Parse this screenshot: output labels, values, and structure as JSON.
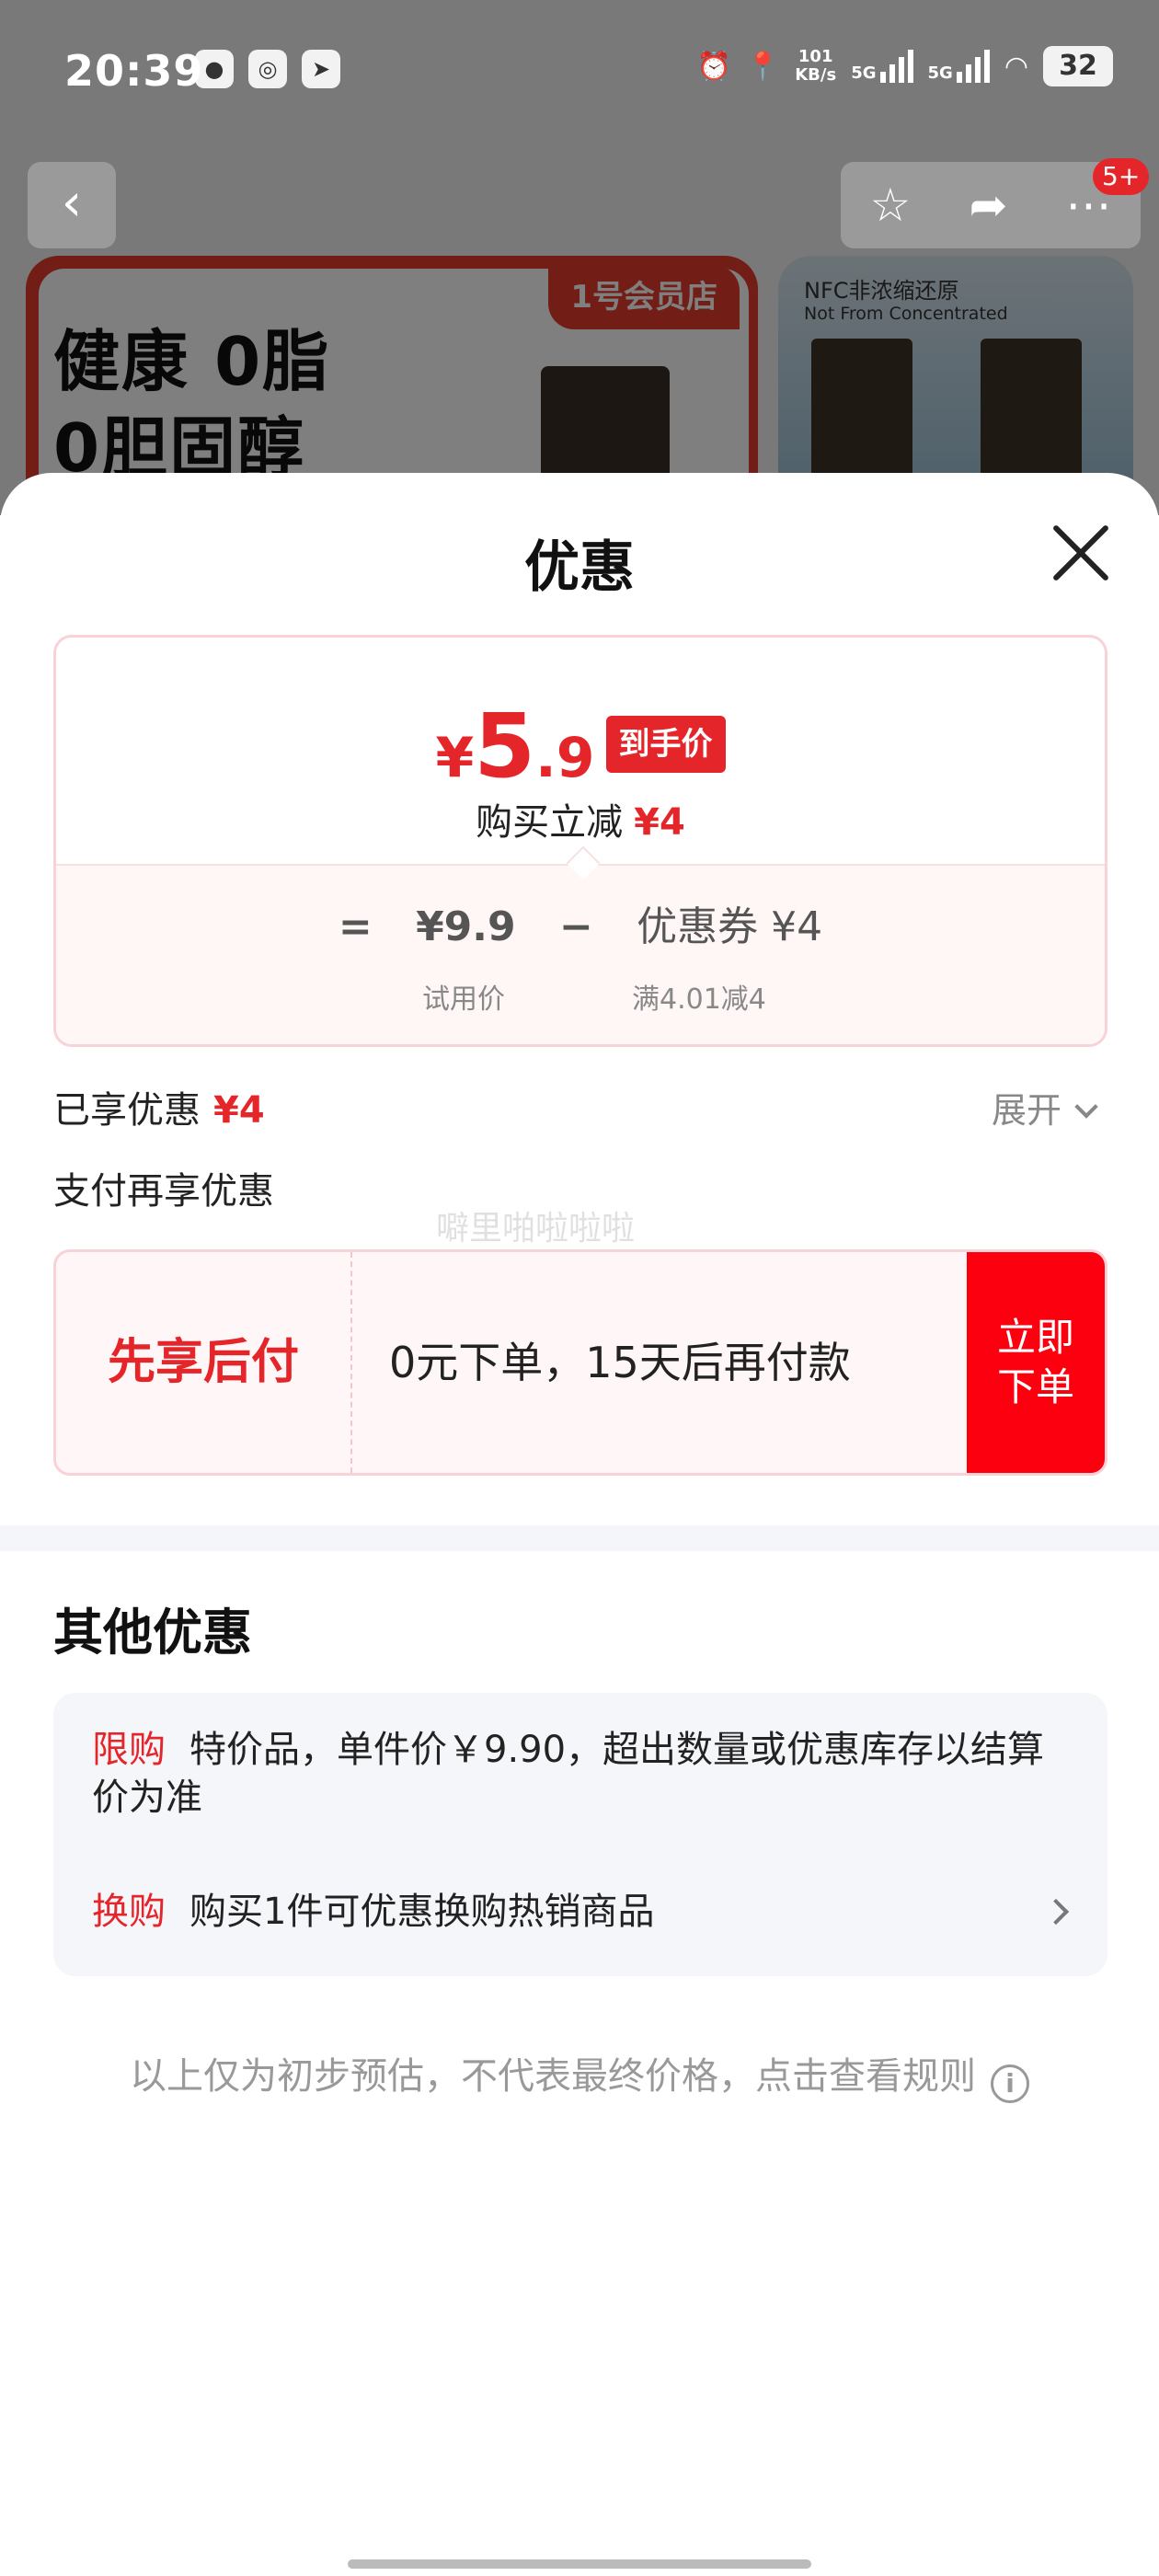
{
  "status_bar": {
    "time": "20:39",
    "net_speed": "101",
    "net_unit": "KB/s",
    "sim1": "5G",
    "sim2": "5G",
    "battery": "32"
  },
  "background": {
    "badge": "5+",
    "banner_left_tag": "1号会员店",
    "banner_left_line1": "健康 0脂",
    "banner_left_line2": "0胆固醇",
    "banner_right_line1": "NFC非浓缩还原",
    "banner_right_line2": "Not From Concentrated"
  },
  "sheet": {
    "title": "优惠",
    "price_card": {
      "currency": "¥",
      "price_int": "5",
      "price_dec": ".9",
      "price_tag": "到手价",
      "reduce_label": "购买立减",
      "reduce_amount": "¥4",
      "eq": "=",
      "trial_price": "¥9.9",
      "minus": "−",
      "coupon_text": "优惠券 ¥4",
      "trial_label": "试用价",
      "coupon_rule": "满4.01减4"
    },
    "enjoyed_label": "已享优惠",
    "enjoyed_amount": "¥4",
    "expand_label": "展开",
    "pay_again_label": "支付再享优惠",
    "watermark": "噼里啪啦啦啦",
    "bnpl": {
      "title": "先享后付",
      "desc": "0元下单，15天后再付款",
      "button": "立即下单"
    },
    "other_title": "其他优惠",
    "promotions": [
      {
        "tag": "限购",
        "text": "特价品，单件价￥9.90，超出数量或优惠库存以结算价为准"
      },
      {
        "tag": "换购",
        "text": "购买1件可优惠换购热销商品"
      }
    ],
    "footnote": "以上仅为初步预估，不代表最终价格，点击查看规则"
  }
}
